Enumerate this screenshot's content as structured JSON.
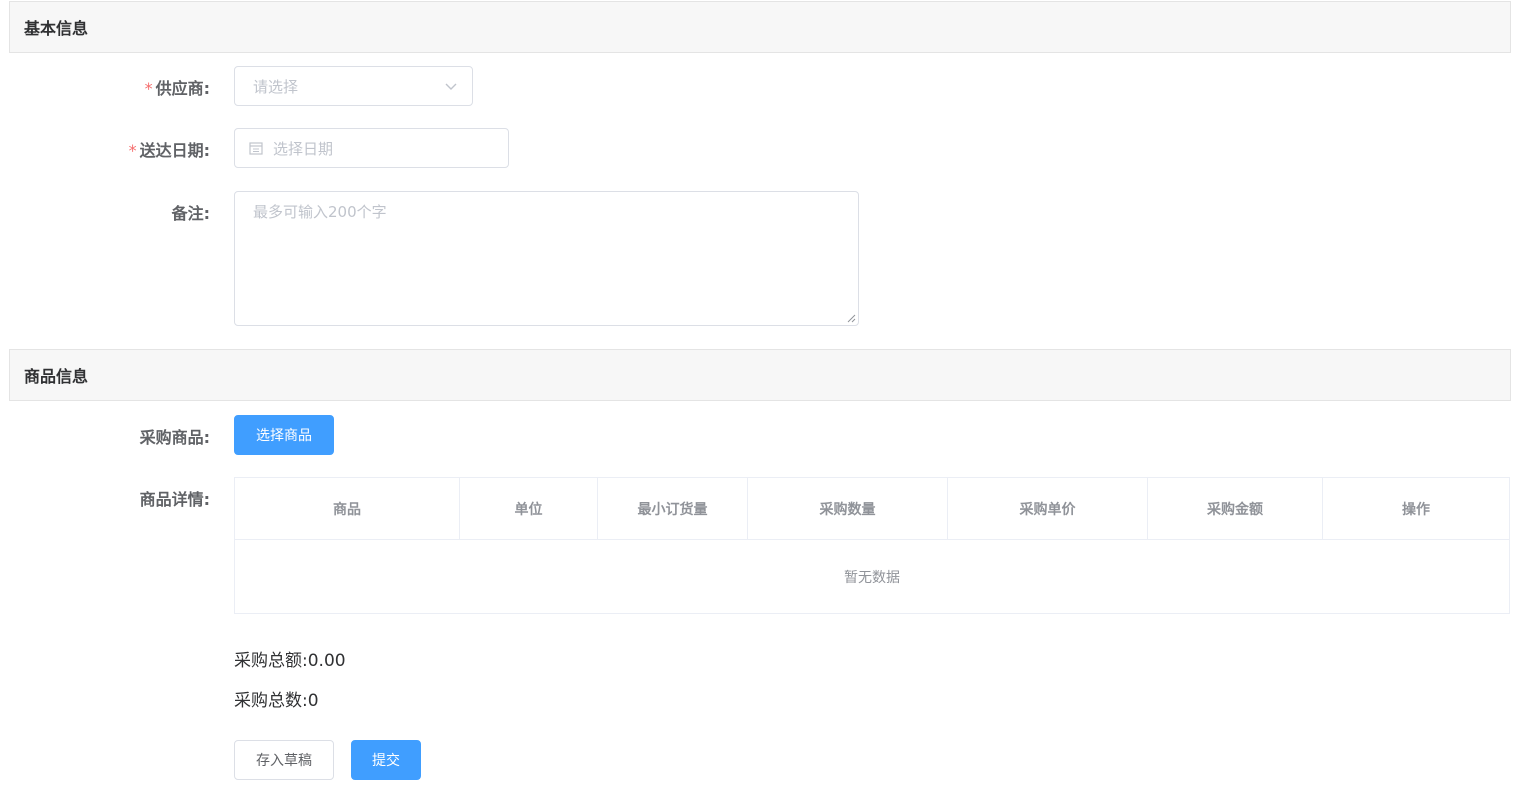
{
  "basic_section": {
    "title": "基本信息"
  },
  "supplier": {
    "required_mark": "*",
    "label": "供应商:",
    "placeholder": "请选择"
  },
  "delivery_date": {
    "required_mark": "*",
    "label": "送达日期:",
    "placeholder": "选择日期"
  },
  "remark": {
    "label": "备注:",
    "placeholder": "最多可输入200个字"
  },
  "goods_section": {
    "title": "商品信息"
  },
  "purchase_goods": {
    "label": "采购商品:",
    "button_label": "选择商品"
  },
  "goods_detail": {
    "label": "商品详情:",
    "columns": [
      "商品",
      "单位",
      "最小订货量",
      "采购数量",
      "采购单价",
      "采购金额",
      "操作"
    ],
    "empty_text": "暂无数据"
  },
  "totals": {
    "amount_label": "采购总额:",
    "amount_value": "0.00",
    "count_label": "采购总数:",
    "count_value": "0"
  },
  "actions": {
    "draft_label": "存入草稿",
    "submit_label": "提交"
  },
  "colors": {
    "primary": "#409eff",
    "required": "#f56c6c",
    "header_bg": "#f7f7f7"
  }
}
